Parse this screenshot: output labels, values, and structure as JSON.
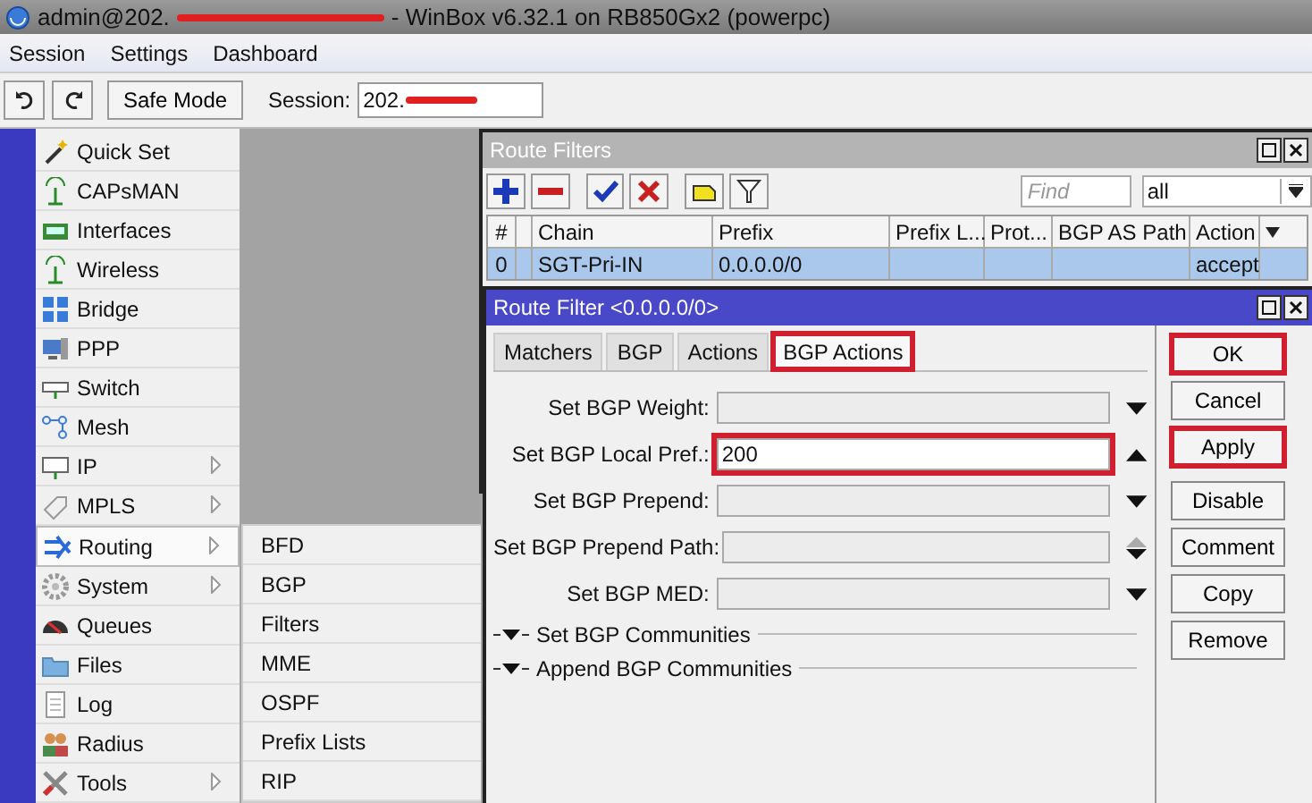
{
  "window": {
    "title_start": "admin@202.",
    "title_end": "- WinBox v6.32.1 on RB850Gx2 (powerpc)"
  },
  "menu": [
    "Session",
    "Settings",
    "Dashboard"
  ],
  "toolbar": {
    "safe_mode": "Safe Mode",
    "session_label": "Session:",
    "session_value": "202."
  },
  "sidebar": {
    "items": [
      {
        "label": "Quick Set",
        "submenu": false,
        "selected": false
      },
      {
        "label": "CAPsMAN",
        "submenu": false,
        "selected": false
      },
      {
        "label": "Interfaces",
        "submenu": false,
        "selected": false
      },
      {
        "label": "Wireless",
        "submenu": false,
        "selected": false
      },
      {
        "label": "Bridge",
        "submenu": false,
        "selected": false
      },
      {
        "label": "PPP",
        "submenu": false,
        "selected": false
      },
      {
        "label": "Switch",
        "submenu": false,
        "selected": false
      },
      {
        "label": "Mesh",
        "submenu": false,
        "selected": false
      },
      {
        "label": "IP",
        "submenu": true,
        "selected": false
      },
      {
        "label": "MPLS",
        "submenu": true,
        "selected": false
      },
      {
        "label": "Routing",
        "submenu": true,
        "selected": true
      },
      {
        "label": "System",
        "submenu": true,
        "selected": false
      },
      {
        "label": "Queues",
        "submenu": false,
        "selected": false
      },
      {
        "label": "Files",
        "submenu": false,
        "selected": false
      },
      {
        "label": "Log",
        "submenu": false,
        "selected": false
      },
      {
        "label": "Radius",
        "submenu": false,
        "selected": false
      },
      {
        "label": "Tools",
        "submenu": true,
        "selected": false
      }
    ]
  },
  "submenu": [
    "BFD",
    "BGP",
    "Filters",
    "MME",
    "OSPF",
    "Prefix Lists",
    "RIP"
  ],
  "route_filters": {
    "title": "Route Filters",
    "find_placeholder": "Find",
    "filter_value": "all",
    "columns": [
      "#",
      "Chain",
      "Prefix",
      "Prefix L...",
      "Prot...",
      "BGP AS Path",
      "Action"
    ],
    "rows": [
      {
        "number": "0",
        "chain": "SGT-Pri-IN",
        "prefix": "0.0.0.0/0",
        "action": "accept",
        "selected": true
      }
    ]
  },
  "dialog": {
    "title": "Route Filter <0.0.0.0/0>",
    "tabs": [
      {
        "label": "Matchers",
        "selected": false,
        "highlighted": false
      },
      {
        "label": "BGP",
        "selected": false,
        "highlighted": false
      },
      {
        "label": "Actions",
        "selected": false,
        "highlighted": false
      },
      {
        "label": "BGP Actions",
        "selected": true,
        "highlighted": true
      }
    ],
    "fields": [
      {
        "label": "Set BGP Weight:",
        "kind": "down",
        "highlighted": false
      },
      {
        "label": "Set BGP Local Pref.:",
        "value": "200",
        "kind": "up",
        "highlighted": true
      },
      {
        "label": "Set BGP Prepend:",
        "kind": "down",
        "highlighted": false
      },
      {
        "label": "Set BGP Prepend Path:",
        "kind": "updown",
        "highlighted": false
      },
      {
        "label": "Set BGP MED:",
        "kind": "down",
        "highlighted": false
      }
    ],
    "sections": [
      "Set BGP Communities",
      "Append BGP Communities"
    ],
    "buttons": [
      {
        "label": "OK",
        "highlighted": true
      },
      {
        "label": "Cancel",
        "highlighted": false
      },
      {
        "label": "Apply",
        "highlighted": true
      },
      {
        "label": "Disable",
        "highlighted": false
      },
      {
        "label": "Comment",
        "highlighted": false
      },
      {
        "label": "Copy",
        "highlighted": false
      },
      {
        "label": "Remove",
        "highlighted": false
      }
    ]
  }
}
